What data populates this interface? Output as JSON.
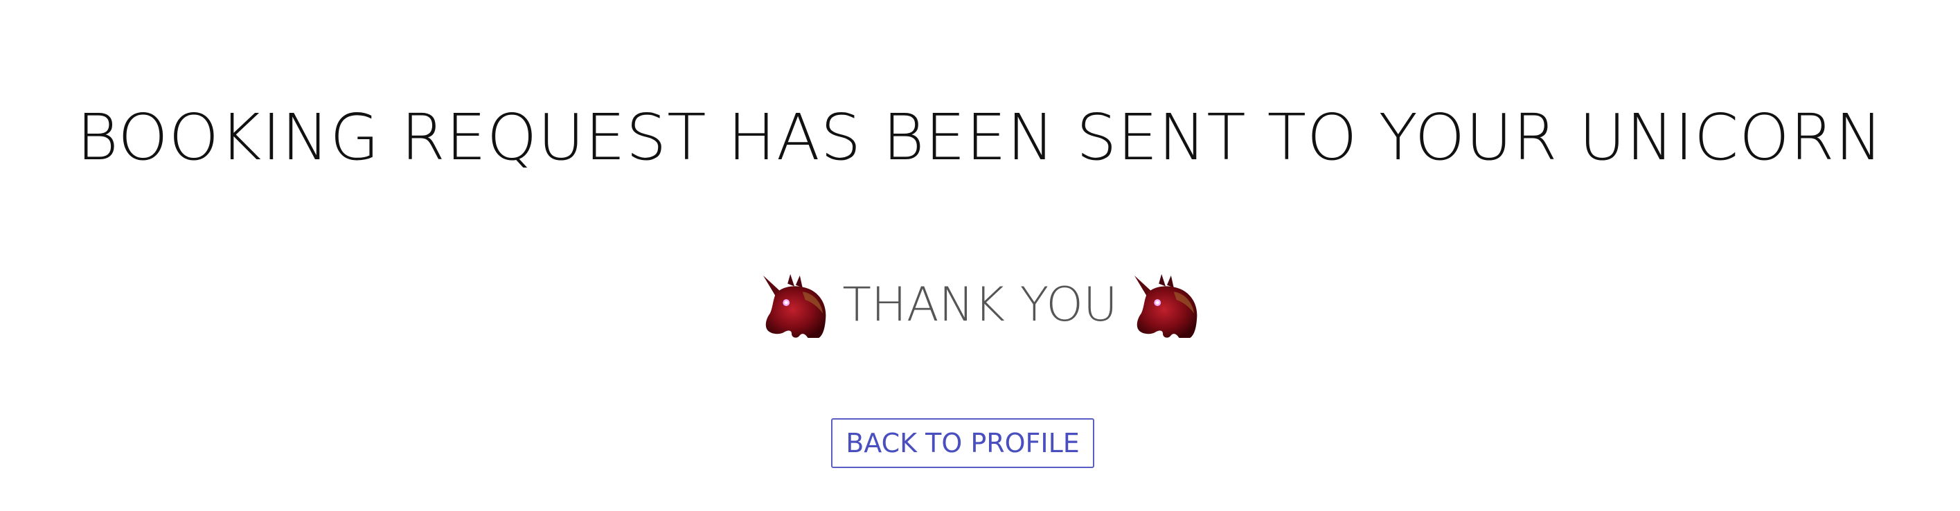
{
  "confirmation": {
    "headline": "BOOKING REQUEST HAS BEEN SENT TO YOUR UNICORN",
    "thank_you": "THANK YOU",
    "left_icon": "unicorn-icon",
    "right_icon": "unicorn-icon"
  },
  "actions": {
    "back_label": "BACK TO PROFILE"
  },
  "colors": {
    "headline": "#111111",
    "thank_you": "#555555",
    "button_border": "#5a5ec4",
    "button_text": "#4a4fbf",
    "unicorn_body": "#7a0a14"
  }
}
